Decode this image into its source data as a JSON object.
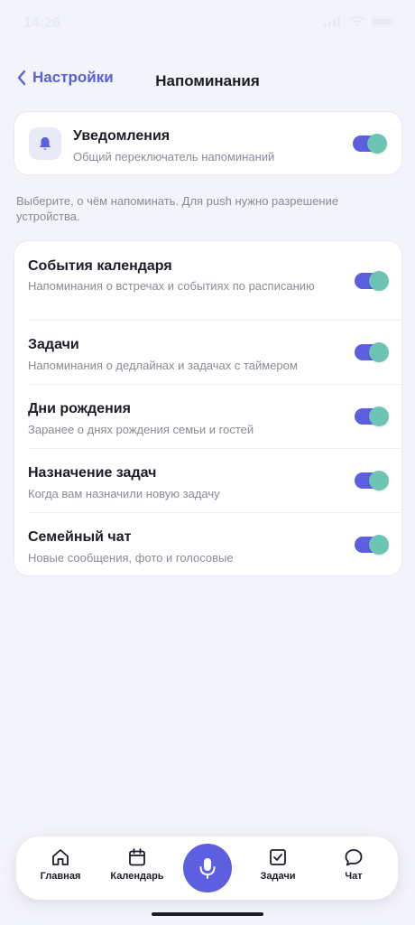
{
  "status": {
    "time": "14:26"
  },
  "header": {
    "back_label": "Настройки",
    "title": "Напоминания"
  },
  "master": {
    "icon": "bell-icon",
    "title": "Уведомления",
    "subtitle": "Общий переключатель напоминаний",
    "enabled": true
  },
  "hint": "Выберите, о чём напоминать. Для push нужно разрешение устройства.",
  "reminders": [
    {
      "title": "События календаря",
      "subtitle": "Напоминания о встречах и событиях по расписанию",
      "enabled": true
    },
    {
      "title": "Задачи",
      "subtitle": "Напоминания о дедлайнах и задачах с таймером",
      "enabled": true
    },
    {
      "title": "Дни рождения",
      "subtitle": "Заранее о днях рождения семьи и гостей",
      "enabled": true
    },
    {
      "title": "Назначение задач",
      "subtitle": "Когда вам назначили новую задачу",
      "enabled": true
    },
    {
      "title": "Семейный чат",
      "subtitle": "Новые сообщения, фото и голосовые",
      "enabled": true
    }
  ],
  "tabs": [
    {
      "label": "Главная",
      "icon": "home-icon"
    },
    {
      "label": "Календарь",
      "icon": "calendar-icon"
    },
    {
      "label": "Задачи",
      "icon": "checkbox-icon"
    },
    {
      "label": "Чат",
      "icon": "chat-bubble-icon"
    }
  ],
  "colors": {
    "accent": "#5b5fe0",
    "toggle_thumb": "#6cc4b4",
    "background": "#f3f3fa"
  }
}
